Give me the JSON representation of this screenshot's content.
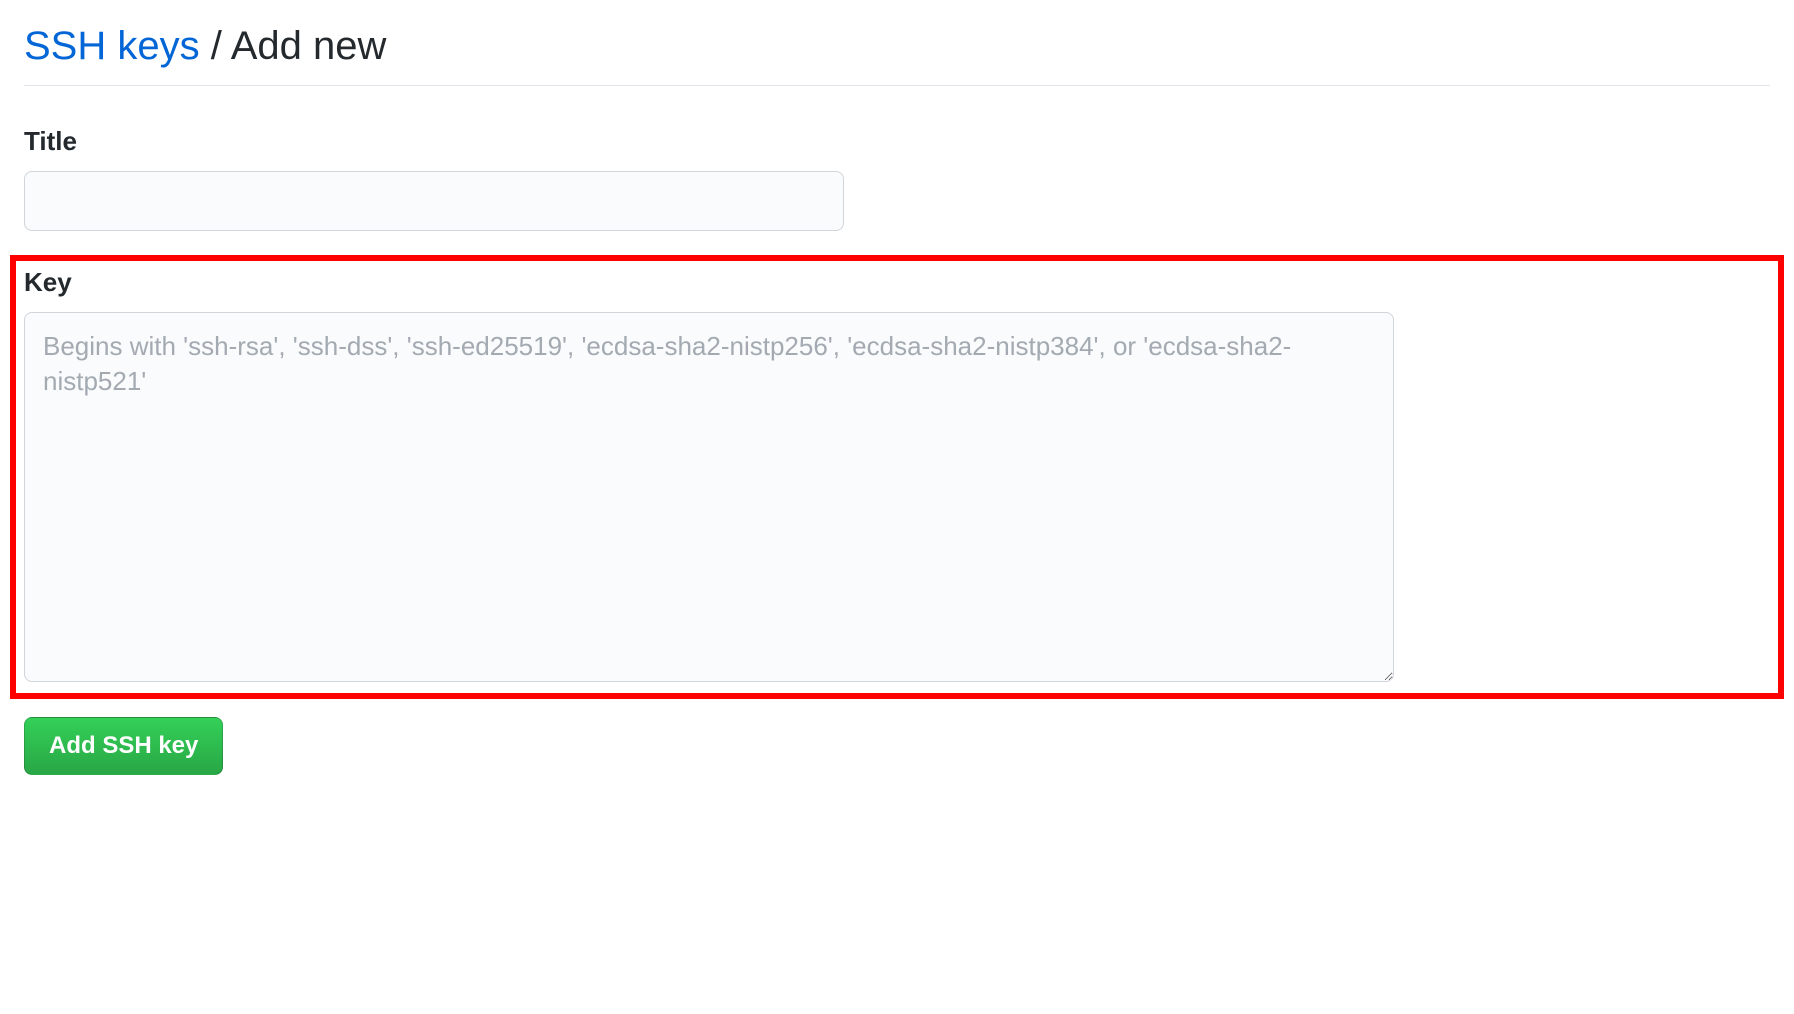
{
  "header": {
    "link_text": "SSH keys",
    "separator": " / ",
    "current_page": "Add new"
  },
  "form": {
    "title_label": "Title",
    "title_value": "",
    "key_label": "Key",
    "key_value": "",
    "key_placeholder": "Begins with 'ssh-rsa', 'ssh-dss', 'ssh-ed25519', 'ecdsa-sha2-nistp256', 'ecdsa-sha2-nistp384', or 'ecdsa-sha2-nistp521'",
    "submit_label": "Add SSH key"
  }
}
